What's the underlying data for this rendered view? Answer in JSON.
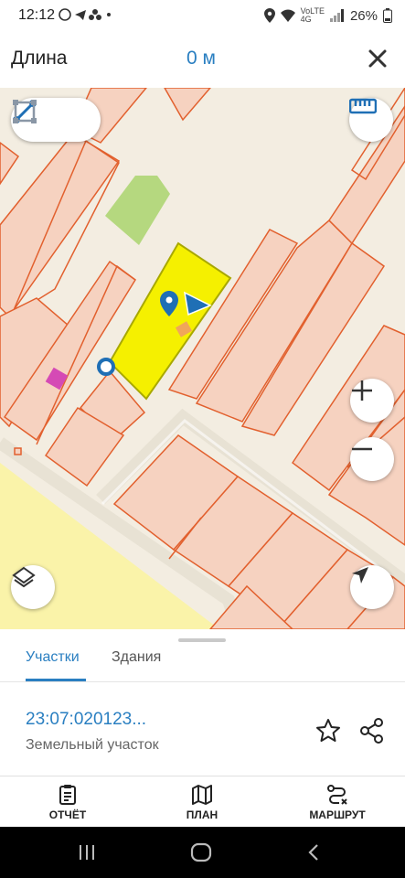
{
  "status_bar": {
    "time": "12:12",
    "left_icons": [
      "whatsapp-icon",
      "telegram-icon",
      "app-icon",
      "dot-icon"
    ],
    "network_top": "VoLTE",
    "network_label": "4G",
    "battery": "26%"
  },
  "header": {
    "label": "Длина",
    "value": "0 м",
    "close_icon": "close-icon"
  },
  "map": {
    "tools": [
      "line-measure-icon",
      "area-measure-icon"
    ],
    "ruler_icon": "ruler-icon",
    "zoom_in_icon": "plus-icon",
    "zoom_out_icon": "minus-icon",
    "layers_icon": "layers-icon",
    "locate_icon": "navigation-arrow-icon",
    "colors": {
      "parcel_fill": "#f6d2c0",
      "parcel_stroke": "#e2602e",
      "selected_fill": "#f5f000",
      "selected_stroke": "#a8a800",
      "field_fill": "#faf3a9",
      "green_area": "#b5d87f",
      "marker": "#1f6fb5"
    }
  },
  "sheet": {
    "tabs": [
      {
        "label": "Участки",
        "active": true
      },
      {
        "label": "Здания",
        "active": false
      }
    ],
    "parcel": {
      "id": "23:07:020123...",
      "type": "Земельный участок"
    },
    "actions": [
      "star-icon",
      "share-icon"
    ]
  },
  "bottom_nav": [
    {
      "label": "ОТЧЁТ",
      "icon": "report-icon"
    },
    {
      "label": "ПЛАН",
      "icon": "map-plan-icon"
    },
    {
      "label": "МАРШРУТ",
      "icon": "route-icon"
    }
  ],
  "accent": "#2a7fc1"
}
